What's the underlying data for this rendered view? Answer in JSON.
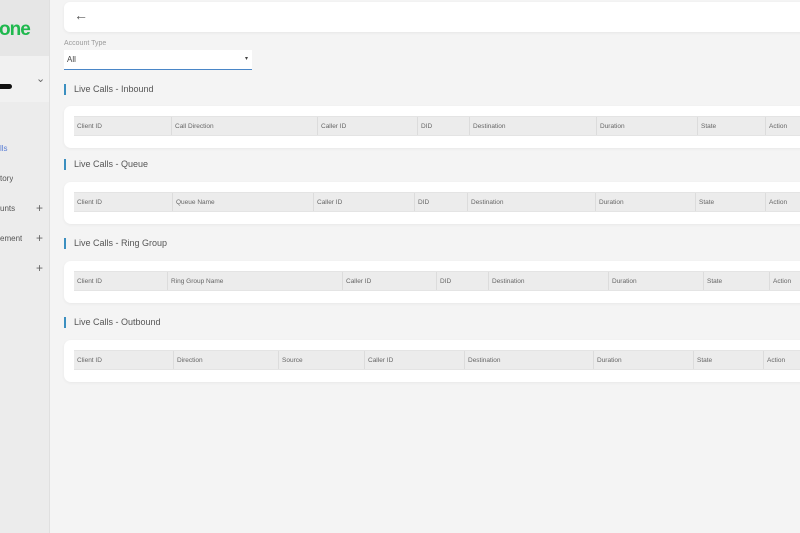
{
  "sidebar": {
    "logo": "one",
    "nav": [
      {
        "label": "lls",
        "active": true,
        "expandable": false
      },
      {
        "label": "tory",
        "active": false,
        "expandable": false
      },
      {
        "label": "unts",
        "active": false,
        "expandable": true
      },
      {
        "label": "ement",
        "active": false,
        "expandable": true
      },
      {
        "label": "",
        "active": false,
        "expandable": true
      }
    ],
    "plus": "+",
    "chevron": "⌄"
  },
  "topbar": {
    "back_icon": "←"
  },
  "filter": {
    "label": "Account Type",
    "value": "All",
    "caret": "▾"
  },
  "sections": [
    {
      "title": "Live Calls - Inbound",
      "columns": [
        "Client ID",
        "Call Direction",
        "Caller ID",
        "DID",
        "Destination",
        "Duration",
        "State",
        "Action"
      ]
    },
    {
      "title": "Live Calls - Queue",
      "columns": [
        "Client ID",
        "Queue Name",
        "Caller ID",
        "DID",
        "Destination",
        "Duration",
        "State",
        "Action"
      ]
    },
    {
      "title": "Live Calls - Ring Group",
      "columns": [
        "Client ID",
        "Ring Group Name",
        "Caller ID",
        "DID",
        "Destination",
        "Duration",
        "State",
        "Action"
      ]
    },
    {
      "title": "Live Calls - Outbound",
      "columns": [
        "Client ID",
        "Direction",
        "Source",
        "Caller ID",
        "Destination",
        "Duration",
        "State",
        "Action"
      ]
    }
  ]
}
